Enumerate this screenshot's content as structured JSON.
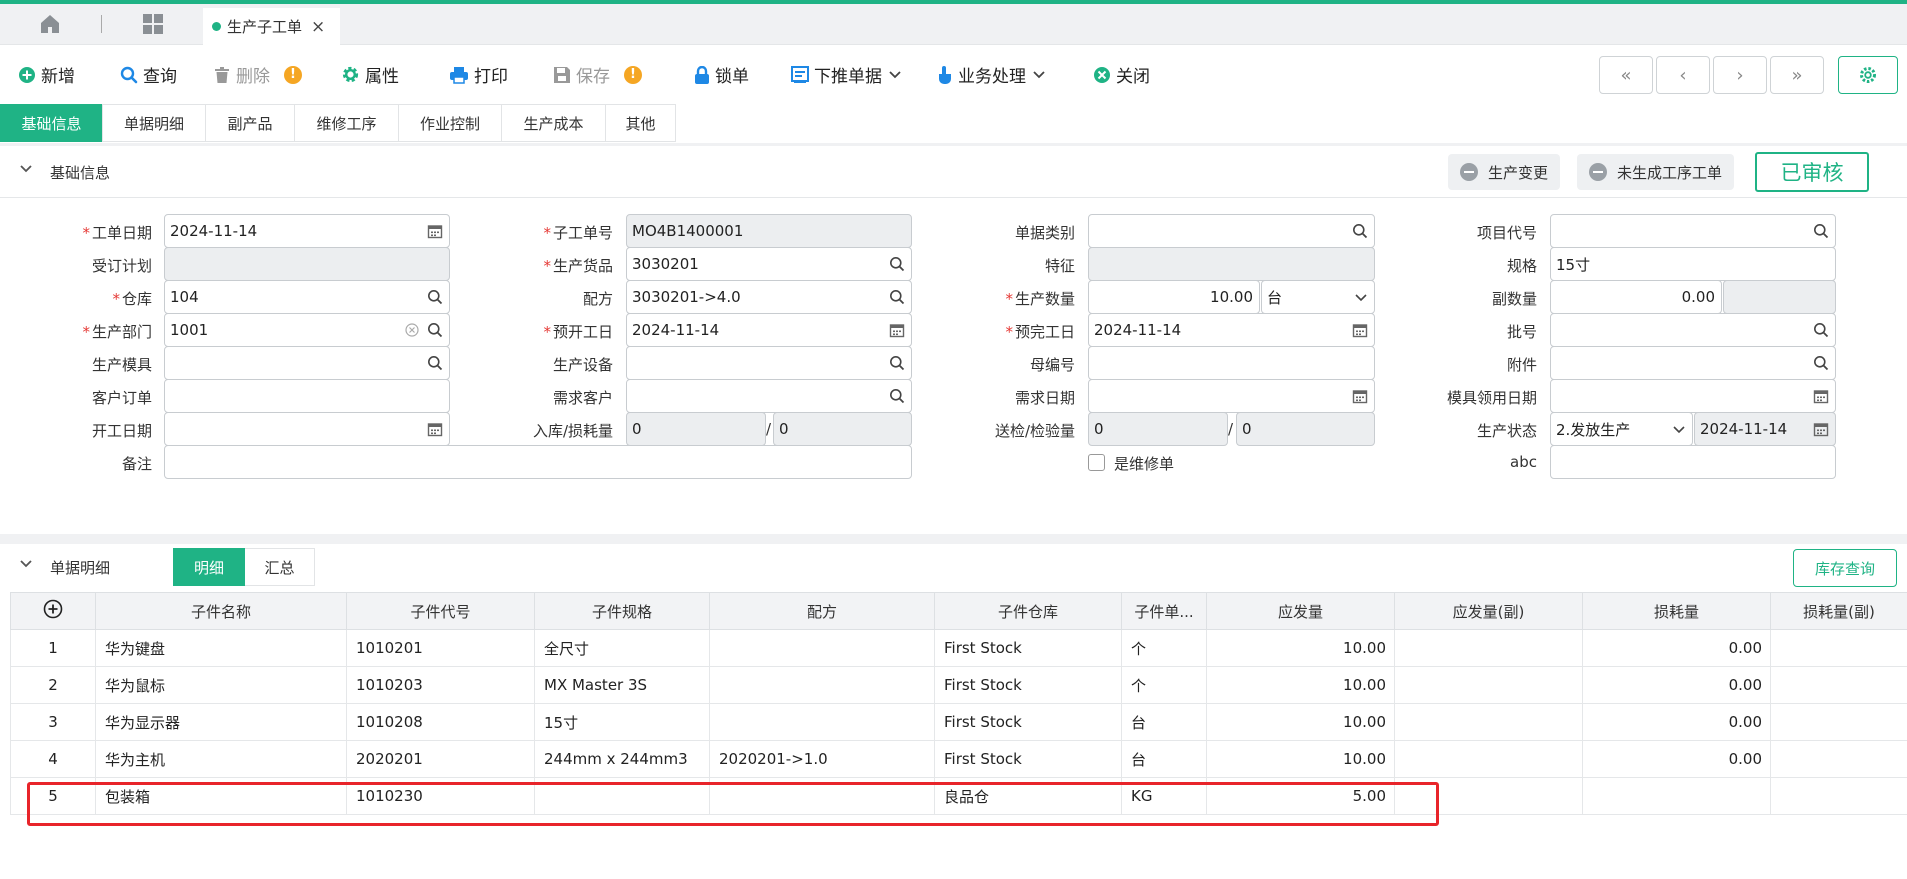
{
  "tabs": {
    "doc_title": "生产子工单",
    "close": "×"
  },
  "toolbar": {
    "add": "新增",
    "query": "查询",
    "delete": "删除",
    "props": "属性",
    "print": "打印",
    "save": "保存",
    "lock": "锁单",
    "push": "下推单据",
    "business": "业务处理",
    "close": "关闭",
    "warn_mark": "!"
  },
  "nav": {
    "first": "«",
    "prev": "‹",
    "next": "›",
    "last": "»"
  },
  "subtabs": [
    "基础信息",
    "单据明细",
    "副产品",
    "维修工序",
    "作业控制",
    "生产成本",
    "其他"
  ],
  "basic": {
    "title": "基础信息",
    "btn_change": "生产变更",
    "btn_nogen": "未生成工序工单",
    "status": "已审核"
  },
  "form": {
    "work_date": {
      "label": "工单日期",
      "value": "2024-11-14"
    },
    "sub_no": {
      "label": "子工单号",
      "value": "MO4B1400001"
    },
    "doc_type": {
      "label": "单据类别",
      "value": ""
    },
    "project_code": {
      "label": "项目代号",
      "value": ""
    },
    "order_plan": {
      "label": "受订计划",
      "value": ""
    },
    "product": {
      "label": "生产货品",
      "value": "3030201"
    },
    "feature": {
      "label": "特征",
      "value": ""
    },
    "spec": {
      "label": "规格",
      "value": "15寸"
    },
    "warehouse": {
      "label": "仓库",
      "value": "104"
    },
    "formula": {
      "label": "配方",
      "value": "3030201->4.0"
    },
    "qty": {
      "label": "生产数量",
      "value": "10.00",
      "unit": "台"
    },
    "sub_qty": {
      "label": "副数量",
      "value": "0.00"
    },
    "dept": {
      "label": "生产部门",
      "value": "1001"
    },
    "plan_start": {
      "label": "预开工日",
      "value": "2024-11-14"
    },
    "plan_end": {
      "label": "预完工日",
      "value": "2024-11-14"
    },
    "batch": {
      "label": "批号",
      "value": ""
    },
    "mold": {
      "label": "生产模具",
      "value": ""
    },
    "equipment": {
      "label": "生产设备",
      "value": ""
    },
    "parent_no": {
      "label": "母编号",
      "value": ""
    },
    "attachment": {
      "label": "附件",
      "value": ""
    },
    "cust_order": {
      "label": "客户订单",
      "value": ""
    },
    "demand_cust": {
      "label": "需求客户",
      "value": ""
    },
    "demand_date": {
      "label": "需求日期",
      "value": ""
    },
    "mold_date": {
      "label": "模具领用日期",
      "value": ""
    },
    "start_date": {
      "label": "开工日期",
      "value": ""
    },
    "in_loss": {
      "label": "入库/损耗量",
      "value1": "0",
      "value2": "0"
    },
    "inspect": {
      "label": "送检/检验量",
      "value1": "0",
      "value2": "0"
    },
    "prod_status": {
      "label": "生产状态",
      "value": "2.发放生产",
      "date": "2024-11-14"
    },
    "remark": {
      "label": "备注",
      "value": ""
    },
    "repair": {
      "label": "是维修单"
    },
    "abc": {
      "label": "abc",
      "value": ""
    }
  },
  "detail": {
    "title": "单据明细",
    "tab_detail": "明细",
    "tab_summary": "汇总",
    "stock_query": "库存查询",
    "columns": [
      "",
      "子件名称",
      "子件代号",
      "子件规格",
      "配方",
      "子件仓库",
      "子件单...",
      "应发量",
      "应发量(副)",
      "损耗量",
      "损耗量(副)"
    ],
    "rows": [
      {
        "no": "1",
        "name": "华为键盘",
        "code": "1010201",
        "spec": "全尺寸",
        "formula": "",
        "wh": "First Stock",
        "unit": "个",
        "qty": "10.00",
        "qty2": "",
        "loss": "0.00",
        "loss2": ""
      },
      {
        "no": "2",
        "name": "华为鼠标",
        "code": "1010203",
        "spec": "MX Master 3S",
        "formula": "",
        "wh": "First Stock",
        "unit": "个",
        "qty": "10.00",
        "qty2": "",
        "loss": "0.00",
        "loss2": ""
      },
      {
        "no": "3",
        "name": "华为显示器",
        "code": "1010208",
        "spec": "15寸",
        "formula": "",
        "wh": "First Stock",
        "unit": "台",
        "qty": "10.00",
        "qty2": "",
        "loss": "0.00",
        "loss2": ""
      },
      {
        "no": "4",
        "name": "华为主机",
        "code": "2020201",
        "spec": "244mm x 244mm3",
        "formula": "2020201->1.0",
        "wh": "First Stock",
        "unit": "台",
        "qty": "10.00",
        "qty2": "",
        "loss": "0.00",
        "loss2": ""
      },
      {
        "no": "5",
        "name": "包装箱",
        "code": "1010230",
        "spec": "",
        "formula": "",
        "wh": "良品仓",
        "unit": "KG",
        "qty": "5.00",
        "qty2": "",
        "loss": "",
        "loss2": ""
      }
    ]
  },
  "colors": {
    "accent": "#1fb385",
    "highlight": "#e8242a",
    "required": "#e53935"
  }
}
